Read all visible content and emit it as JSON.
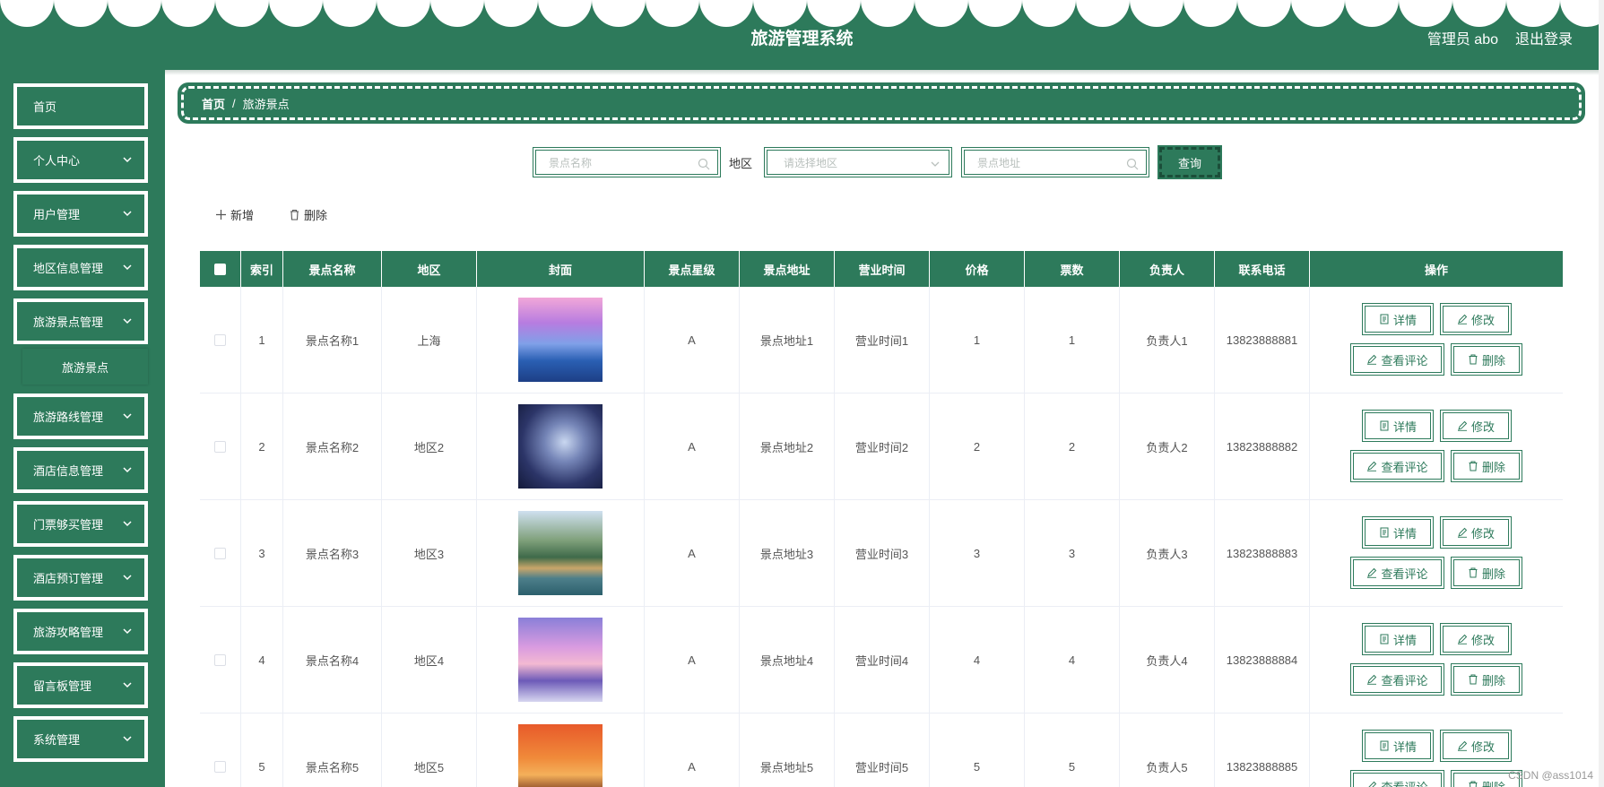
{
  "header": {
    "title": "旅游管理系统",
    "user": "管理员 abo",
    "logout": "退出登录"
  },
  "sidebar": {
    "items": [
      {
        "label": "首页",
        "expandable": false
      },
      {
        "label": "个人中心",
        "expandable": true
      },
      {
        "label": "用户管理",
        "expandable": true
      },
      {
        "label": "地区信息管理",
        "expandable": true
      },
      {
        "label": "旅游景点管理",
        "expandable": true
      },
      {
        "label": "旅游路线管理",
        "expandable": true
      },
      {
        "label": "酒店信息管理",
        "expandable": true
      },
      {
        "label": "门票够买管理",
        "expandable": true
      },
      {
        "label": "酒店预订管理",
        "expandable": true
      },
      {
        "label": "旅游攻略管理",
        "expandable": true
      },
      {
        "label": "留言板管理",
        "expandable": true
      },
      {
        "label": "系统管理",
        "expandable": true
      }
    ],
    "sub_item": "旅游景点"
  },
  "breadcrumb": {
    "home": "首页",
    "separator": "/",
    "current": "旅游景点"
  },
  "search": {
    "name_placeholder": "景点名称",
    "area_label": "地区",
    "area_placeholder": "请选择地区",
    "address_placeholder": "景点地址",
    "query_label": "查询"
  },
  "actions": {
    "add_label": "新增",
    "delete_label": "删除"
  },
  "table": {
    "columns": [
      "",
      "索引",
      "景点名称",
      "地区",
      "封面",
      "景点星级",
      "景点地址",
      "营业时间",
      "价格",
      "票数",
      "负责人",
      "联系电话",
      "操作"
    ],
    "rows": [
      {
        "index": "1",
        "name": "景点名称1",
        "area": "上海",
        "star": "A",
        "address": "景点地址1",
        "hours": "营业时间1",
        "price": "1",
        "tickets": "1",
        "manager": "负责人1",
        "phone": "13823888881",
        "cover": "sunset-pool"
      },
      {
        "index": "2",
        "name": "景点名称2",
        "area": "地区2",
        "star": "A",
        "address": "景点地址2",
        "hours": "营业时间2",
        "price": "2",
        "tickets": "2",
        "manager": "负责人2",
        "phone": "13823888882",
        "cover": "night-sky"
      },
      {
        "index": "3",
        "name": "景点名称3",
        "area": "地区3",
        "star": "A",
        "address": "景点地址3",
        "hours": "营业时间3",
        "price": "3",
        "tickets": "3",
        "manager": "负责人3",
        "phone": "13823888883",
        "cover": "bridge-mountains"
      },
      {
        "index": "4",
        "name": "景点名称4",
        "area": "地区4",
        "star": "A",
        "address": "景点地址4",
        "hours": "营业时间4",
        "price": "4",
        "tickets": "4",
        "manager": "负责人4",
        "phone": "13823888884",
        "cover": "purple-clouds"
      },
      {
        "index": "5",
        "name": "景点名称5",
        "area": "地区5",
        "star": "A",
        "address": "景点地址5",
        "hours": "营业时间5",
        "price": "5",
        "tickets": "5",
        "manager": "负责人5",
        "phone": "13823888885",
        "cover": "orange-sunset"
      }
    ],
    "op_labels": {
      "detail": "详情",
      "edit": "修改",
      "comments": "查看评论",
      "delete": "删除"
    }
  },
  "watermark": "CSDN @ass1014",
  "colors": {
    "primary": "#2d7a5b",
    "white": "#ffffff"
  }
}
